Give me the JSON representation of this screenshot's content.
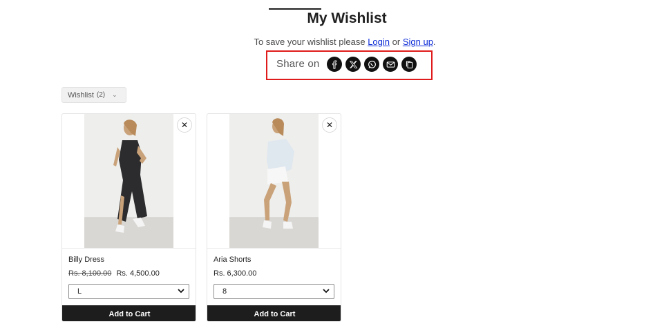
{
  "page": {
    "title": "My Wishlist"
  },
  "save_prompt": {
    "prefix": "To save your wishlist please",
    "login": "Login",
    "or": "or",
    "signup": "Sign up",
    "suffix": "."
  },
  "share": {
    "label": "Share on",
    "icons": [
      "facebook-icon",
      "x-icon",
      "whatsapp-icon",
      "email-icon",
      "copy-link-icon"
    ]
  },
  "filter": {
    "label": "Wishlist",
    "count": "(2)"
  },
  "products": [
    {
      "name": "Billy Dress",
      "old_price": "Rs. 8,100.00",
      "price": "Rs. 4,500.00",
      "size": "L",
      "button": "Add to Cart",
      "close": "✕"
    },
    {
      "name": "Aria Shorts",
      "old_price": "",
      "price": "Rs. 6,300.00",
      "size": "8",
      "button": "Add to Cart",
      "close": "✕"
    }
  ],
  "colors": {
    "highlight": "#e01b1b",
    "link": "#0b2bd6",
    "button": "#1d1d1d"
  }
}
